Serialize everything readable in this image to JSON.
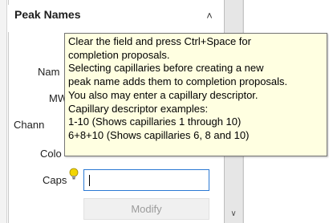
{
  "panel": {
    "title": "Peak Names",
    "collapse_icon": "double-chevron-up-icon"
  },
  "form": {
    "name_label": "Nam",
    "mw_label": "MW",
    "channel_label": "Chann",
    "color_label": "Colo",
    "caps_label": "Caps",
    "caps_value": "",
    "modify_label": "Modify"
  },
  "tooltip": {
    "lines": [
      "Clear the field and press Ctrl+Space for",
      "completion proposals.",
      "Selecting capillaries before creating a new",
      "peak name adds them to completion proposals.",
      "You also may enter a capillary descriptor.",
      "Capillary descriptor examples:",
      "1-10 (Shows capillaries 1 through 10)",
      "6+8+10 (Shows capillaries 6, 8 and 10)"
    ]
  },
  "scrollbar": {
    "down_icon": "chevron-down-icon"
  },
  "hint": {
    "icon": "lightbulb-icon",
    "color": "#f2d500"
  }
}
